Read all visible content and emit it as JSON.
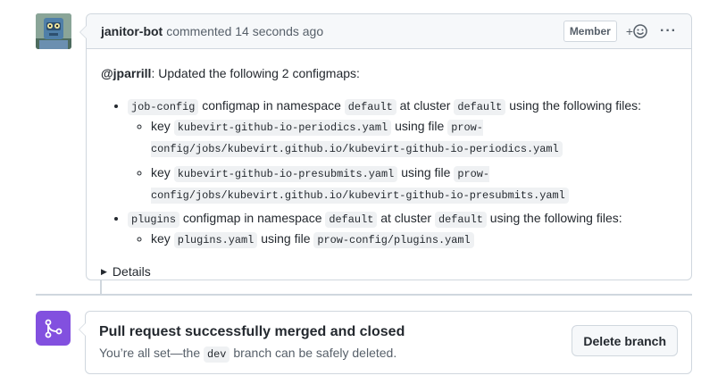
{
  "comment": {
    "author": "janitor-bot",
    "action": "commented",
    "time": "14 seconds ago",
    "role_badge": "Member",
    "reaction_label": "+",
    "menu_label": "···",
    "intro": {
      "mention": "@jparrill",
      "text": ": Updated the following 2 configmaps:"
    },
    "configmaps": [
      {
        "name": "job-config",
        "t1": "configmap in namespace",
        "namespace": "default",
        "t2": "at cluster",
        "cluster": "default",
        "t3": "using the following files:",
        "files": [
          {
            "key_label": "key",
            "key": "kubevirt-github-io-periodics.yaml",
            "using_label": "using file",
            "file": "prow-config/jobs/kubevirt.github.io/kubevirt-github-io-periodics.yaml"
          },
          {
            "key_label": "key",
            "key": "kubevirt-github-io-presubmits.yaml",
            "using_label": "using file",
            "file": "prow-config/jobs/kubevirt.github.io/kubevirt-github-io-presubmits.yaml"
          }
        ]
      },
      {
        "name": "plugins",
        "t1": "configmap in namespace",
        "namespace": "default",
        "t2": "at cluster",
        "cluster": "default",
        "t3": "using the following files:",
        "files": [
          {
            "key_label": "key",
            "key": "plugins.yaml",
            "using_label": "using file",
            "file": "prow-config/plugins.yaml"
          }
        ]
      }
    ],
    "details_label": "Details"
  },
  "merge": {
    "title": "Pull request successfully merged and closed",
    "sub_before": "You’re all set—the",
    "branch": "dev",
    "sub_after": "branch can be safely deleted.",
    "delete_label": "Delete branch"
  },
  "colors": {
    "merged_purple": "#8250df",
    "border": "#d0d7de",
    "header_bg": "#f6f8fa"
  },
  "icons": {
    "avatar": "robot-avatar",
    "reaction": "smiley-icon",
    "menu": "kebab-icon",
    "merge": "git-merge-icon",
    "details": "triangle-right-icon"
  }
}
